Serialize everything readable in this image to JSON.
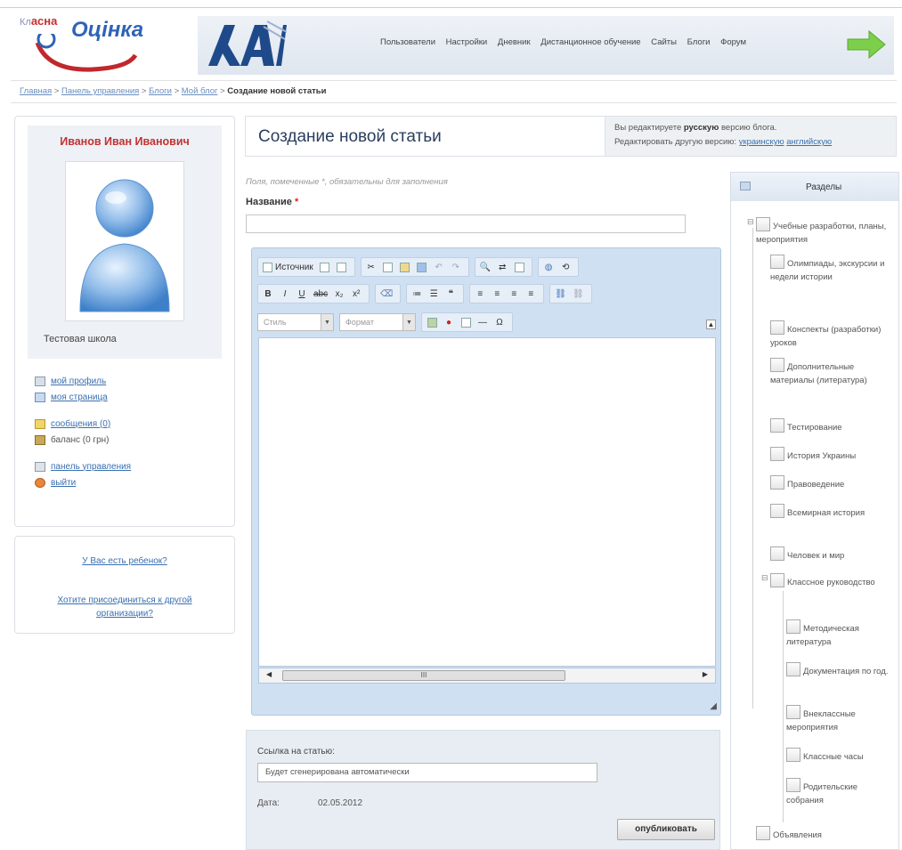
{
  "header": {
    "logo_kl": "Кл",
    "logo_asna": "асна",
    "logo_ocinka": "Оцінка",
    "nav": [
      "Пользователи",
      "Настройки",
      "Дневник",
      "Дистанционное обучение",
      "Сайты",
      "Блоги",
      "Форум"
    ]
  },
  "breadcrumb": {
    "items": [
      "Главная",
      "Панель управления",
      "Блоги",
      "Мой блог"
    ],
    "current": "Создание новой статьи",
    "separator": " > "
  },
  "profile": {
    "name": "Иванов Иван Иванович",
    "school": "Тестовая школа",
    "links": {
      "my_profile": "мой профиль",
      "my_page": "моя страница",
      "messages": "сообщения (0)",
      "balance": "баланс (0 грн)",
      "control_panel": "панель управления",
      "logout": "выйти"
    }
  },
  "ask": {
    "q1": "У Вас есть ребенок?",
    "q2": "Хотите присоединиться к другой организации?"
  },
  "main": {
    "title": "Создание новой статьи",
    "lang_line1_prefix": "Вы редактируете",
    "lang_line1_bold": "русскую",
    "lang_line1_suffix": "версию блога.",
    "lang_line2_prefix": "Редактировать другую версию:",
    "lang_ukr": "украинскую",
    "lang_eng": "английскую",
    "required_note": "Поля, помеченные *, обязательны для заполнения",
    "name_label": "Название",
    "required_mark": "*"
  },
  "editor": {
    "source_label": "Источник",
    "style_placeholder": "Стиль",
    "format_placeholder": "Формат",
    "scroll_grip": "III"
  },
  "link_box": {
    "label": "Ссылка на статью:",
    "value": "Будет сгенерирована автоматически",
    "date_label": "Дата:",
    "date_value": "02.05.2012",
    "publish_button": "опубликовать"
  },
  "sections": {
    "title": "Разделы",
    "items": {
      "i1": "Учебные разработки, планы, мероприятия",
      "i2": "Олимпиады, экскурсии и недели истории",
      "i3": "Конспекты (разработки) уроков",
      "i4": "Дополнительные материалы (литература)",
      "i5": "Тестирование",
      "i6": "История Украины",
      "i7": "Правоведение",
      "i8": "Всемирная история",
      "i9": "Человек и мир",
      "i10": "Классное руководство",
      "i11": "Методическая литература",
      "i12": "Документация по год.",
      "i13": "Внеклассные мероприятия",
      "i14": "Классные часы",
      "i15": "Родительские собрания",
      "i16": "Объявления"
    }
  },
  "colors": {
    "accent_red": "#c23232",
    "link_blue": "#3a6fb0",
    "editor_bg": "#cfe0f3"
  }
}
